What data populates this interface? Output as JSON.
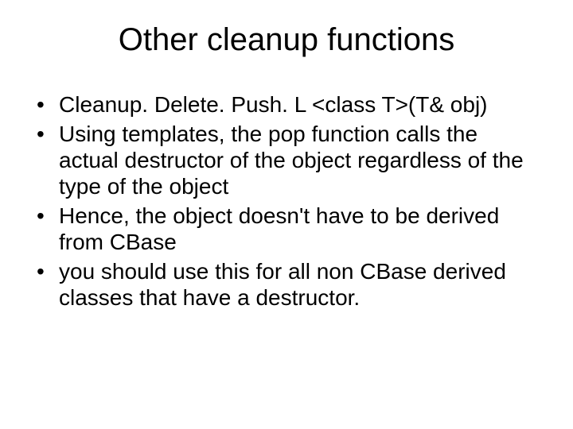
{
  "slide": {
    "title": "Other cleanup functions",
    "bullets": [
      "Cleanup. Delete. Push. L <class T>(T& obj)",
      "Using templates, the pop function calls the actual destructor of the object regardless of the type of the object",
      "Hence, the object doesn't have to be derived from CBase",
      "you should use this for all non CBase derived classes that have a destructor."
    ]
  }
}
